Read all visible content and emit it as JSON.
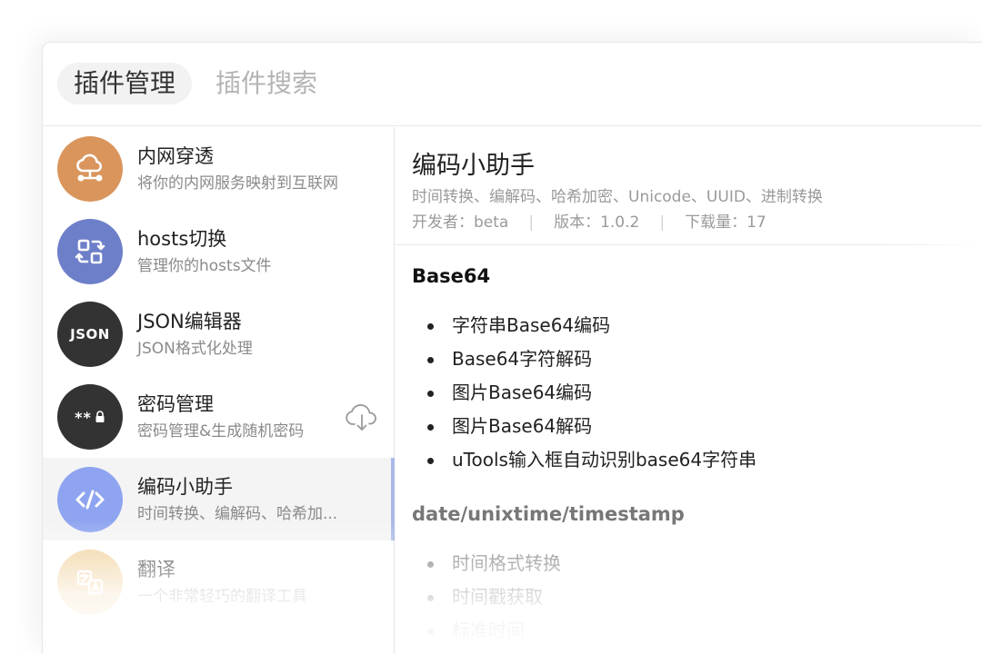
{
  "header": {
    "tab_manage": "插件管理",
    "tab_search": "插件搜索"
  },
  "plugins": [
    {
      "title": "内网穿透",
      "desc": "将你的内网服务映射到互联网",
      "icon": "cloud-network-icon",
      "color": "#d9955c"
    },
    {
      "title": "hosts切换",
      "desc": "管理你的hosts文件",
      "icon": "switch-icon",
      "color": "#6e7fc9"
    },
    {
      "title": "JSON编辑器",
      "desc": "JSON格式化处理",
      "icon": "json-icon",
      "icon_text": "JSON",
      "color": "#333333"
    },
    {
      "title": "密码管理",
      "desc": "密码管理&生成随机密码",
      "icon": "password-icon",
      "icon_text": "**",
      "color": "#333333",
      "download": "cloud-download-icon"
    },
    {
      "title": "编码小助手",
      "desc": "时间转换、编解码、哈希加...",
      "icon": "code-icon",
      "color": "#8ea4f0",
      "selected": true
    },
    {
      "title": "翻译",
      "desc": "一个非常轻巧的翻译工具",
      "icon": "translate-icon",
      "color": "#f0cf98"
    }
  ],
  "detail": {
    "title": "编码小助手",
    "tags": "时间转换、编解码、哈希加密、Unicode、UUID、进制转换",
    "developer": "开发者：beta",
    "version": "版本：1.0.2",
    "downloads": "下载量：17",
    "sections": [
      {
        "title": "Base64",
        "items": [
          "字符串Base64编码",
          "Base64字符解码",
          "图片Base64编码",
          "图片Base64解码",
          "uTools输入框自动识别base64字符串"
        ]
      },
      {
        "title": "date/unixtime/timestamp",
        "items": [
          "时间格式转换",
          "时间戳获取",
          "标准时间"
        ]
      }
    ]
  }
}
